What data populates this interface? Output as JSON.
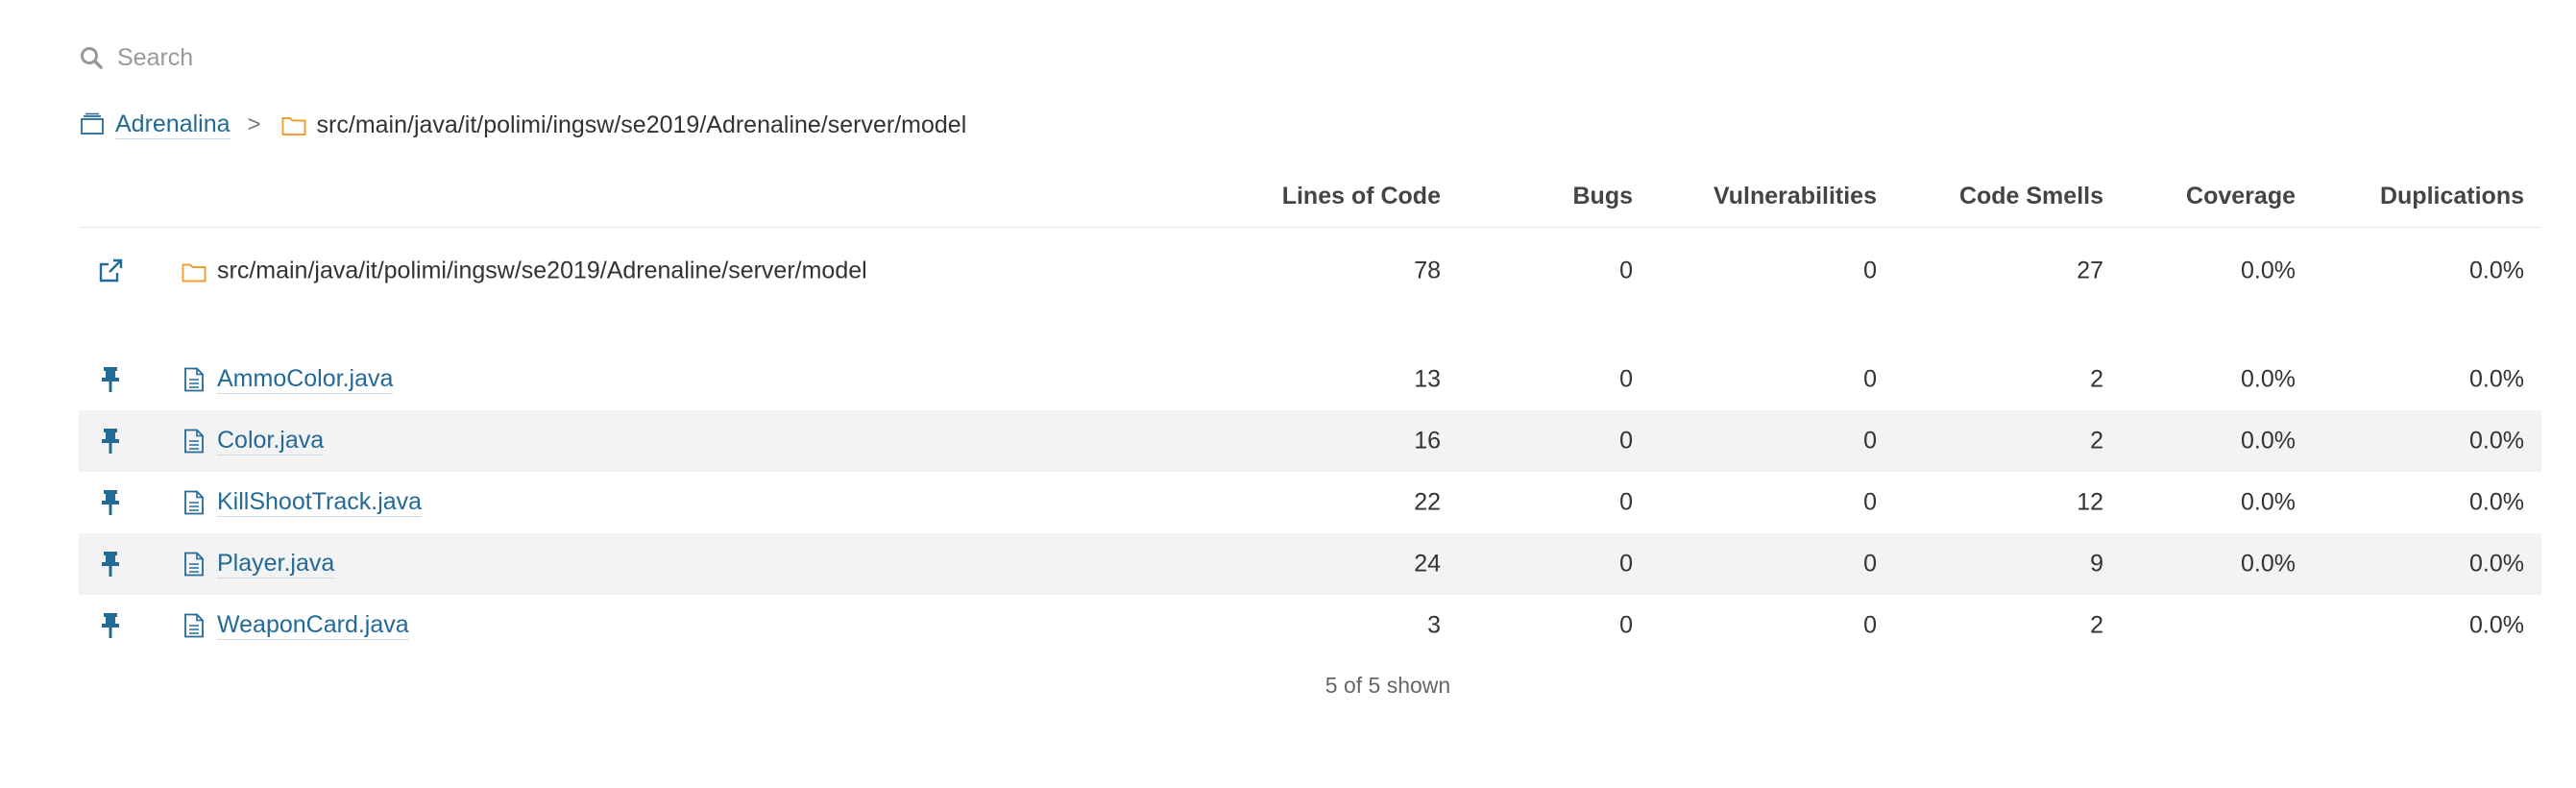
{
  "search": {
    "placeholder": "Search"
  },
  "breadcrumb": {
    "project": "Adrenalina",
    "separator": ">",
    "path": "src/main/java/it/polimi/ingsw/se2019/Adrenaline/server/model"
  },
  "columns": {
    "loc": "Lines of Code",
    "bugs": "Bugs",
    "vulnerabilities": "Vulnerabilities",
    "code_smells": "Code Smells",
    "coverage": "Coverage",
    "duplications": "Duplications"
  },
  "base_row": {
    "icon": "external-link-icon",
    "name": "src/main/java/it/polimi/ingsw/se2019/Adrenaline/server/model",
    "loc": "78",
    "bugs": "0",
    "vulnerabilities": "0",
    "code_smells": "27",
    "coverage": "0.0%",
    "duplications": "0.0%"
  },
  "rows": [
    {
      "name": "AmmoColor.java",
      "loc": "13",
      "bugs": "0",
      "vulnerabilities": "0",
      "code_smells": "2",
      "coverage": "0.0%",
      "duplications": "0.0%"
    },
    {
      "name": "Color.java",
      "loc": "16",
      "bugs": "0",
      "vulnerabilities": "0",
      "code_smells": "2",
      "coverage": "0.0%",
      "duplications": "0.0%"
    },
    {
      "name": "KillShootTrack.java",
      "loc": "22",
      "bugs": "0",
      "vulnerabilities": "0",
      "code_smells": "12",
      "coverage": "0.0%",
      "duplications": "0.0%"
    },
    {
      "name": "Player.java",
      "loc": "24",
      "bugs": "0",
      "vulnerabilities": "0",
      "code_smells": "9",
      "coverage": "0.0%",
      "duplications": "0.0%"
    },
    {
      "name": "WeaponCard.java",
      "loc": "3",
      "bugs": "0",
      "vulnerabilities": "0",
      "code_smells": "2",
      "coverage": "",
      "duplications": "0.0%"
    }
  ],
  "footer": {
    "shown": "5 of 5 shown"
  },
  "icons": {
    "row_pin": "pin-icon",
    "file": "file-icon",
    "folder": "folder-icon",
    "project": "project-icon",
    "search": "search-icon"
  },
  "colors": {
    "link": "#236a97",
    "folder": "#f0a030",
    "icon_blue": "#236a97",
    "alt_row": "#f3f3f3"
  }
}
